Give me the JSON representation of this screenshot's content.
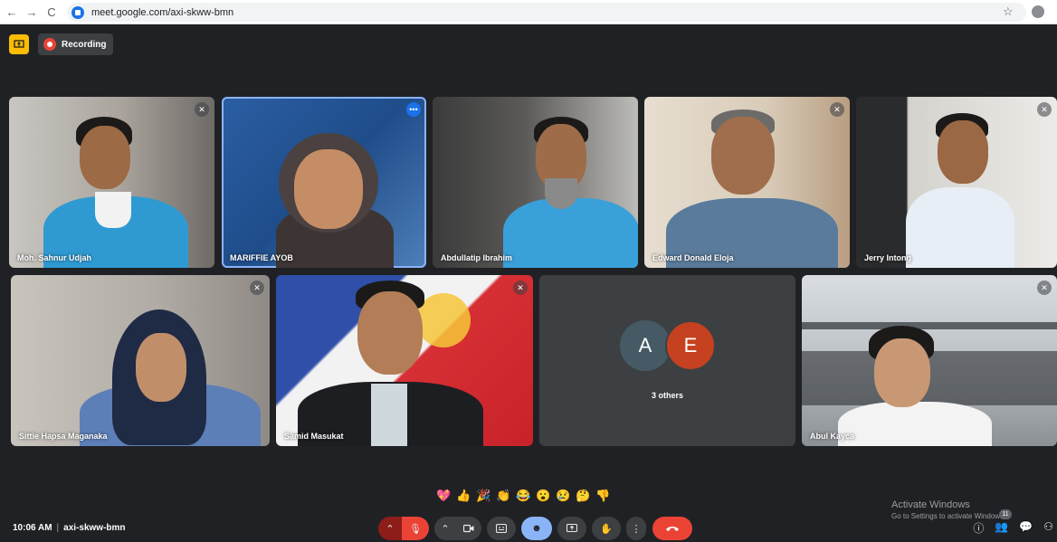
{
  "browser": {
    "url": "meet.google.com/axi-skww-bmn",
    "back": "←",
    "forward": "→",
    "reload": "C",
    "star": "☆"
  },
  "topbar": {
    "recording_label": "Recording",
    "present_icon": "present-to-all-icon"
  },
  "participants": [
    {
      "name": "Moh. Sahnur Udjah",
      "muted": true
    },
    {
      "name": "MARIFFIE AYOB",
      "muted": false,
      "active": true
    },
    {
      "name": "Abdullatip Ibrahim",
      "muted": false
    },
    {
      "name": "Edward Donald Eloja",
      "muted": true
    },
    {
      "name": "Jerry Intong",
      "muted": true
    },
    {
      "name": "Sittie Hapsa Maganaka",
      "muted": true
    },
    {
      "name": "Samid Masukat",
      "muted": true
    },
    {
      "name": "Abul Kayca",
      "muted": true
    }
  ],
  "others": {
    "avatars": [
      {
        "letter": "A",
        "color": "#455a64"
      },
      {
        "letter": "E",
        "color": "#c5411f"
      }
    ],
    "label": "3 others"
  },
  "reactions": [
    "💖",
    "👍",
    "🎉",
    "👏",
    "😂",
    "😮",
    "😢",
    "🤔",
    "👎"
  ],
  "bottom": {
    "time": "10:06 AM",
    "separator": "|",
    "meeting_code": "axi-skww-bmn",
    "participant_count": "11"
  },
  "watermark": {
    "title": "Activate Windows",
    "subtitle": "Go to Settings to activate Windows."
  },
  "colors": {
    "background": "#202124",
    "leave_red": "#ea4335",
    "active_blue": "#8ab4f8",
    "present_yellow": "#fbbc04"
  }
}
